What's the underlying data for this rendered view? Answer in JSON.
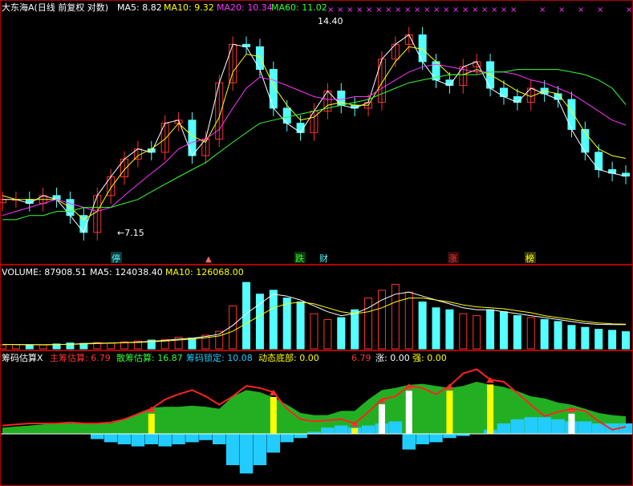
{
  "colors": {
    "background": "#000000",
    "frame": "#b40000",
    "up_candle": "#ff3333",
    "down_candle": "#54ffff",
    "ma5": "#ffffff",
    "ma10": "#ffff00",
    "ma20": "#ff33ff",
    "ma60": "#33ff33",
    "main_chips": "#ff2222",
    "scattered_chips": "#22b022",
    "locked_chips": "#22ccff",
    "bottom_signal": "#ffff00"
  },
  "header": {
    "title": "大东海A(日线 前复权 对数)",
    "ma5": "MA5: 8.82",
    "ma10": "MA10: 9.32",
    "ma20": "MA20: 10.34",
    "ma60": "MA60: 11.02"
  },
  "annotations": {
    "high": "14.40",
    "low": "←7.15",
    "markers": [
      {
        "label": "停",
        "color": "#54ffff"
      },
      {
        "label": "跌",
        "color": "#33ff33"
      },
      {
        "label": "财",
        "color": "#54ffff"
      },
      {
        "label": "涨",
        "color": "#ff3333"
      },
      {
        "label": "榜",
        "color": "#ffff00"
      }
    ]
  },
  "volume_header": {
    "volume": "VOLUME: 87908.51",
    "ma5": "MA5: 124038.40",
    "ma10": "MA10: 126068.00"
  },
  "chips_header": {
    "name": "筹码估算X",
    "main": "主筹估算: 6.79",
    "scattered": "散筹估算: 16.87",
    "locked": "筹码锁定: 10.08",
    "bottom": "动态底部: 0.00",
    "value": "6.79",
    "rise": "涨: 0.00",
    "strong": "强: 0.00"
  },
  "chart_data": [
    {
      "type": "line",
      "title": "大东海A(日线 前复权 对数)",
      "x": [
        0,
        5,
        10,
        15,
        20,
        25,
        30,
        35,
        40,
        45,
        50,
        55,
        60,
        65,
        70,
        75,
        80,
        85,
        90,
        95,
        100,
        105,
        110,
        115,
        120,
        125,
        130,
        135,
        140,
        145,
        150,
        155,
        160,
        165,
        170,
        175,
        180,
        185,
        190,
        195,
        200,
        205,
        210,
        215,
        220,
        225,
        230
      ],
      "series": [
        {
          "name": "MA5",
          "values": [
            8.2,
            8.2,
            8.1,
            8.3,
            8.2,
            7.8,
            7.4,
            8.3,
            8.8,
            9.3,
            9.6,
            9.5,
            10.4,
            10.5,
            9.4,
            9.9,
            11.8,
            13.3,
            13.2,
            12.3,
            10.9,
            10.4,
            10.1,
            10.8,
            11.5,
            11.0,
            10.9,
            11.1,
            12.7,
            13.3,
            13.7,
            12.6,
            11.9,
            11.7,
            12.4,
            12.6,
            11.6,
            11.3,
            11.1,
            11.6,
            11.4,
            11.2,
            10.2,
            9.5,
            9.0,
            8.9,
            8.82
          ]
        },
        {
          "name": "MA10",
          "values": [
            8.3,
            8.2,
            8.2,
            8.2,
            8.2,
            8.0,
            7.7,
            7.9,
            8.5,
            9.0,
            9.4,
            9.6,
            9.9,
            10.4,
            10.0,
            9.8,
            10.6,
            12.2,
            12.9,
            12.8,
            11.7,
            11.0,
            10.5,
            10.6,
            11.0,
            11.1,
            11.0,
            11.0,
            11.8,
            12.6,
            13.2,
            13.1,
            12.6,
            12.1,
            12.1,
            12.3,
            12.1,
            11.8,
            11.5,
            11.3,
            11.5,
            11.4,
            10.8,
            10.1,
            9.6,
            9.4,
            9.32
          ]
        },
        {
          "name": "MA20",
          "values": [
            7.8,
            7.9,
            8.0,
            8.1,
            8.2,
            8.1,
            8.0,
            7.9,
            8.0,
            8.3,
            8.6,
            8.9,
            9.2,
            9.6,
            9.8,
            9.9,
            10.2,
            10.9,
            11.6,
            12.0,
            11.9,
            11.7,
            11.5,
            11.3,
            11.2,
            11.2,
            11.3,
            11.3,
            11.6,
            11.9,
            12.2,
            12.4,
            12.5,
            12.4,
            12.3,
            12.2,
            12.2,
            12.2,
            12.1,
            11.9,
            11.8,
            11.6,
            11.4,
            11.1,
            10.8,
            10.5,
            10.34
          ]
        },
        {
          "name": "MA60",
          "values": [
            7.7,
            7.7,
            7.8,
            7.8,
            7.9,
            7.9,
            8.0,
            8.0,
            8.0,
            8.1,
            8.2,
            8.4,
            8.6,
            8.8,
            9.0,
            9.2,
            9.5,
            9.8,
            10.1,
            10.4,
            10.5,
            10.6,
            10.7,
            10.8,
            10.9,
            11.0,
            11.1,
            11.2,
            11.4,
            11.6,
            11.8,
            11.9,
            12.0,
            12.1,
            12.1,
            12.1,
            12.2,
            12.2,
            12.3,
            12.3,
            12.3,
            12.3,
            12.2,
            12.1,
            11.9,
            11.6,
            11.02
          ]
        }
      ],
      "ylim": [
        7,
        14.6
      ],
      "grid": false
    },
    {
      "type": "bar",
      "title": "VOLUME",
      "x": [
        0,
        5,
        10,
        15,
        20,
        25,
        30,
        35,
        40,
        45,
        50,
        55,
        60,
        65,
        70,
        75,
        80,
        85,
        90,
        95,
        100,
        105,
        110,
        115,
        120,
        125,
        130,
        135,
        140,
        145,
        150,
        155,
        160,
        165,
        170,
        175,
        180,
        185,
        190,
        195,
        200,
        205,
        210,
        215,
        220,
        225,
        230
      ],
      "values": [
        20000,
        22000,
        18000,
        20000,
        25000,
        30000,
        28000,
        32000,
        30000,
        36000,
        40000,
        45000,
        48000,
        60000,
        55000,
        70000,
        90000,
        220000,
        340000,
        280000,
        300000,
        260000,
        240000,
        180000,
        150000,
        160000,
        200000,
        260000,
        300000,
        330000,
        290000,
        240000,
        210000,
        200000,
        180000,
        170000,
        200000,
        190000,
        170000,
        160000,
        150000,
        140000,
        120000,
        110000,
        100000,
        95000,
        87908.51
      ],
      "series": [
        {
          "name": "MA5",
          "values": [
            22000,
            22000,
            21000,
            21000,
            22000,
            24000,
            27000,
            29000,
            30000,
            32000,
            35000,
            39000,
            43000,
            50000,
            55000,
            63000,
            75000,
            120000,
            180000,
            230000,
            280000,
            270000,
            250000,
            220000,
            190000,
            170000,
            180000,
            210000,
            250000,
            280000,
            290000,
            270000,
            250000,
            230000,
            210000,
            200000,
            200000,
            190000,
            180000,
            170000,
            160000,
            150000,
            140000,
            130000,
            125000,
            124000,
            124038.4
          ]
        },
        {
          "name": "MA10",
          "values": [
            23000,
            22000,
            22000,
            21000,
            22000,
            23000,
            25000,
            27000,
            29000,
            31000,
            33000,
            36000,
            40000,
            45000,
            50000,
            57000,
            66000,
            90000,
            130000,
            170000,
            210000,
            230000,
            240000,
            230000,
            210000,
            190000,
            180000,
            190000,
            210000,
            240000,
            260000,
            260000,
            250000,
            240000,
            225000,
            215000,
            210000,
            205000,
            195000,
            185000,
            170000,
            160000,
            150000,
            140000,
            132000,
            128000,
            126068.0
          ]
        }
      ]
    },
    {
      "type": "area",
      "title": "筹码估算X",
      "x": [
        0,
        5,
        10,
        15,
        20,
        25,
        30,
        35,
        40,
        45,
        50,
        55,
        60,
        65,
        70,
        75,
        80,
        85,
        90,
        95,
        100,
        105,
        110,
        115,
        120,
        125,
        130,
        135,
        140,
        145,
        150,
        155,
        160,
        165,
        170,
        175,
        180,
        185,
        190,
        195,
        200,
        205,
        210,
        215,
        220,
        225,
        230
      ],
      "series": [
        {
          "name": "主筹估算",
          "values": [
            8,
            9,
            10,
            10,
            10,
            11,
            10,
            10,
            11,
            14,
            19,
            24,
            33,
            38,
            42,
            36,
            28,
            36,
            46,
            44,
            40,
            24,
            14,
            12,
            13,
            14,
            10,
            21,
            33,
            36,
            46,
            44,
            38,
            46,
            58,
            62,
            52,
            50,
            39,
            28,
            17,
            21,
            24,
            22,
            12,
            4,
            6.79
          ]
        },
        {
          "name": "散筹估算",
          "values": [
            6,
            7,
            8,
            9,
            10,
            10,
            10,
            10,
            10,
            14,
            20,
            25,
            26,
            26,
            27,
            26,
            24,
            36,
            42,
            40,
            35,
            28,
            20,
            18,
            18,
            22,
            22,
            33,
            42,
            44,
            47,
            48,
            46,
            44,
            46,
            50,
            47,
            45,
            41,
            36,
            34,
            30,
            28,
            24,
            20,
            18,
            16.87
          ]
        },
        {
          "name": "筹码锁定",
          "values": [
            0,
            0,
            0,
            0,
            0,
            0,
            0,
            -5,
            -8,
            -10,
            -12,
            -10,
            -12,
            -10,
            -8,
            -6,
            -10,
            -30,
            -38,
            -30,
            -18,
            -8,
            -4,
            2,
            6,
            8,
            6,
            8,
            10,
            12,
            -15,
            -10,
            -8,
            -4,
            -2,
            0,
            4,
            10,
            14,
            16,
            16,
            14,
            12,
            12,
            10,
            10,
            10.08
          ]
        },
        {
          "name": "动态底部",
          "values": [
            0,
            0,
            0,
            0,
            0,
            0,
            0,
            0,
            0,
            0,
            0,
            0,
            0,
            0,
            0,
            0,
            0,
            0,
            0,
            0,
            0,
            0,
            0,
            0,
            0,
            0,
            0,
            0,
            0,
            0,
            0,
            0,
            0,
            0,
            0,
            0,
            0,
            0,
            0,
            0,
            0,
            0,
            0,
            0,
            0,
            0,
            0.0
          ]
        }
      ]
    }
  ]
}
